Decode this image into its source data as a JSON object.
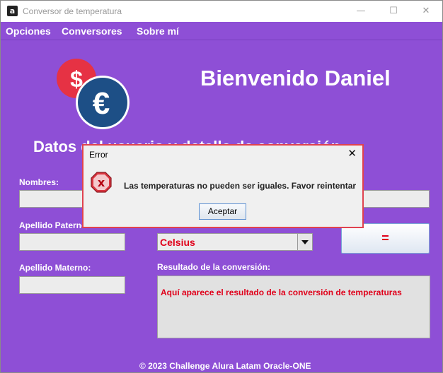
{
  "window": {
    "title": "Conversor de temperatura",
    "app_icon": "a",
    "controls": {
      "minimize": "—",
      "maximize": "☐",
      "close": "✕"
    }
  },
  "menu": {
    "items": [
      "Opciones",
      "Conversores",
      "Sobre mí"
    ]
  },
  "header": {
    "welcome": "Bienvenido Daniel",
    "logo_icons": {
      "dollar": "$",
      "euro": "€"
    }
  },
  "form": {
    "section_title": "Datos del usuario y detalle de conversión",
    "labels": {
      "nombres": "Nombres:",
      "apellido_paterno": "Apellido Paterno:",
      "apellido_materno": "Apellido Materno:",
      "resultado": "Resultado de la conversión:"
    },
    "values": {
      "nombres": "",
      "apellido_paterno": "",
      "apellido_materno": "",
      "value_field": ""
    },
    "select_value": "Celsius",
    "equals_button": "=",
    "result_text": "Aquí aparece el resultado de la conversión de temperaturas"
  },
  "footer": "© 2023 Challenge Alura Latam Oracle-ONE",
  "dialog": {
    "title": "Error",
    "close": "✕",
    "icon_glyph": "x",
    "message": "Las temperaturas no pueden ser iguales. Favor reintentar",
    "ok_button": "Aceptar"
  },
  "colors": {
    "background": "#8e4fd6",
    "accent_red": "#e0001a",
    "dialog_border": "#e0424f",
    "logo_red": "#e63244",
    "logo_blue": "#1d4f86"
  }
}
